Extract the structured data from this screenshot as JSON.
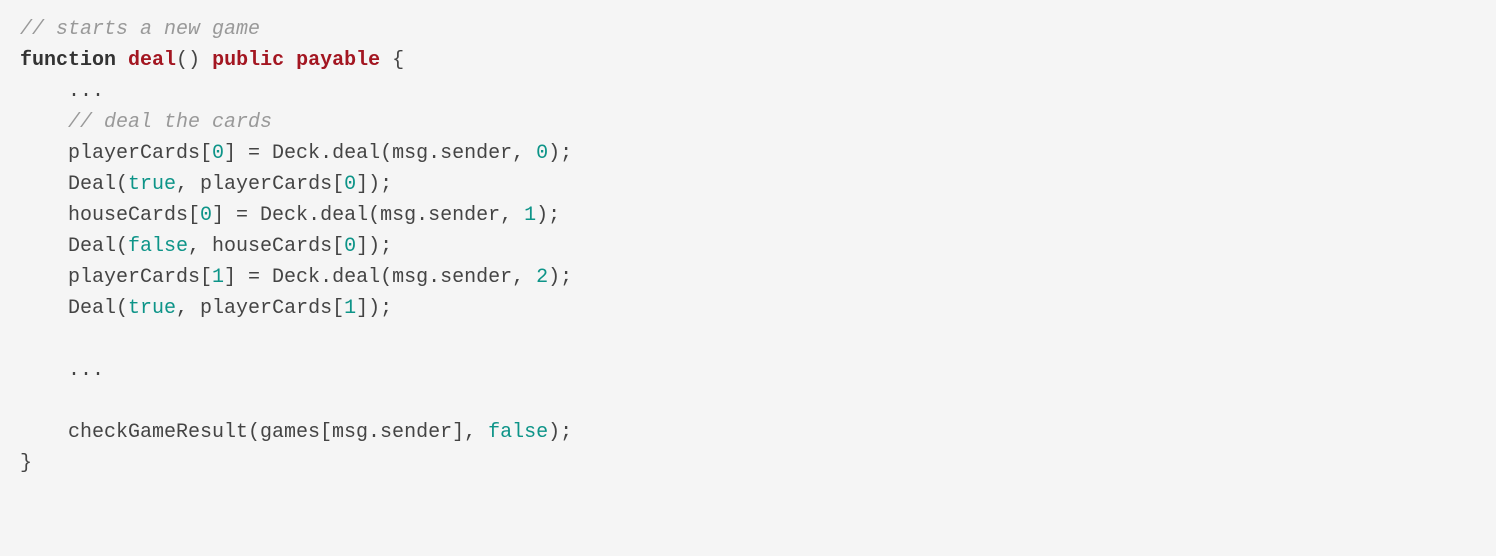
{
  "code": {
    "comment1": "// starts a new game",
    "kw_function": "function",
    "fn_name": "deal",
    "paren_open": "(",
    "paren_close": ")",
    "mod_public": "public",
    "mod_payable": "payable",
    "brace_open": "{",
    "ellipsis1": "    ...",
    "comment2": "    // deal the cards",
    "l1a": "    playerCards[",
    "l1b": "0",
    "l1c": "] = Deck.deal(msg.sender, ",
    "l1d": "0",
    "l1e": ");",
    "l2a": "    Deal(",
    "l2b": "true",
    "l2c": ", playerCards[",
    "l2d": "0",
    "l2e": "]);",
    "l3a": "    houseCards[",
    "l3b": "0",
    "l3c": "] = Deck.deal(msg.sender, ",
    "l3d": "1",
    "l3e": ");",
    "l4a": "    Deal(",
    "l4b": "false",
    "l4c": ", houseCards[",
    "l4d": "0",
    "l4e": "]);",
    "l5a": "    playerCards[",
    "l5b": "1",
    "l5c": "] = Deck.deal(msg.sender, ",
    "l5d": "2",
    "l5e": ");",
    "l6a": "    Deal(",
    "l6b": "true",
    "l6c": ", playerCards[",
    "l6d": "1",
    "l6e": "]);",
    "blank1": "",
    "ellipsis2": "    ...",
    "blank2": "",
    "l7a": "    checkGameResult(games[msg.sender], ",
    "l7b": "false",
    "l7c": ");",
    "brace_close": "}"
  }
}
